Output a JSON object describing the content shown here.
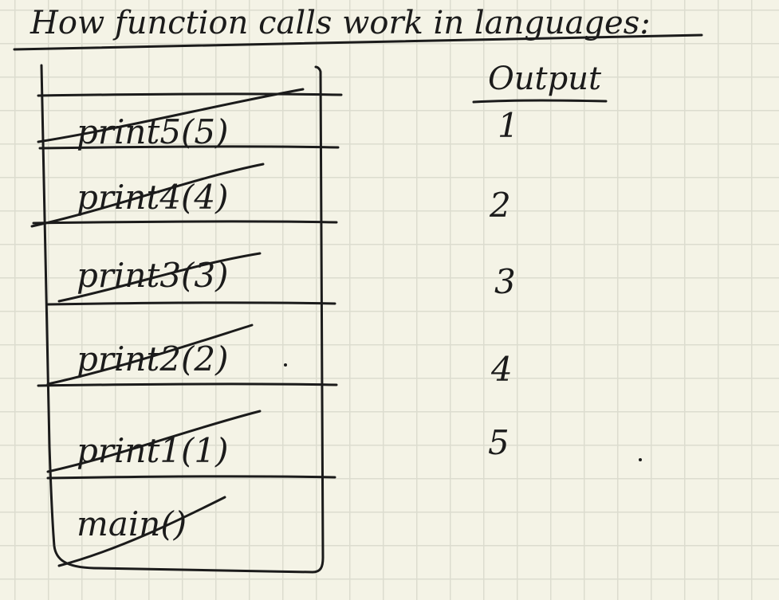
{
  "title": "How function calls work in languages:",
  "stack": {
    "frames": [
      {
        "label": "print5(5)",
        "struck": true
      },
      {
        "label": "print4(4)",
        "struck": true
      },
      {
        "label": "print3(3)",
        "struck": true
      },
      {
        "label": "print2(2)",
        "struck": true
      },
      {
        "label": "print1(1)",
        "struck": true
      },
      {
        "label": "main()",
        "struck": true
      }
    ]
  },
  "output": {
    "heading": "Output",
    "values": [
      "1",
      "2",
      "3",
      "4",
      "5"
    ]
  },
  "colors": {
    "paper": "#f4f3e6",
    "grid": "#dcdccf",
    "ink": "#1b1b1b"
  }
}
